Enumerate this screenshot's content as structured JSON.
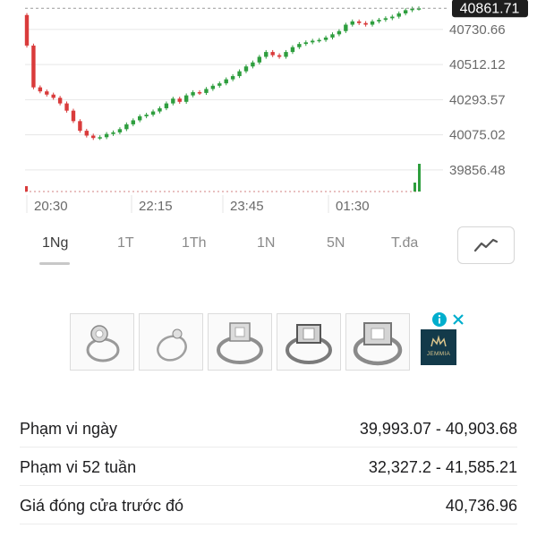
{
  "chart": {
    "current_price_label": "40861.71",
    "y_ticks": [
      "40730.66",
      "40512.12",
      "40293.57",
      "40075.02",
      "39856.48"
    ],
    "x_ticks": [
      "20:30",
      "22:15",
      "23:45",
      "01:30"
    ],
    "colors": {
      "up": "#2e9e3e",
      "down": "#d93b3b",
      "grid": "#e6e6e6",
      "label_bg": "#1e1e1e"
    }
  },
  "tabs": [
    "1Ng",
    "1T",
    "1Th",
    "1N",
    "5N",
    "T.đa"
  ],
  "active_tab": "1Ng",
  "chart_toggle_icon": "line-chart-icon",
  "ad": {
    "thumbnails": [
      "ring-1",
      "ring-2",
      "ring-3",
      "ring-4",
      "ring-5"
    ],
    "brand": "JEMMIA",
    "info_icon": "info-icon",
    "close_icon": "close-icon"
  },
  "stats": [
    {
      "label": "Phạm vi ngày",
      "value": "39,993.07 - 40,903.68"
    },
    {
      "label": "Phạm vi 52 tuần",
      "value": "32,327.2 - 41,585.21"
    },
    {
      "label": "Giá đóng cửa trước đó",
      "value": "40,736.96"
    }
  ],
  "chart_data": {
    "type": "line",
    "title": "",
    "xlabel": "",
    "ylabel": "",
    "x_ticks": [
      "20:30",
      "22:15",
      "23:45",
      "01:30"
    ],
    "ylim": [
      39800,
      40880
    ],
    "y_ticks": [
      40730.66,
      40512.12,
      40293.57,
      40075.02,
      39856.48
    ],
    "last_price": 40861.71,
    "series": [
      {
        "name": "",
        "values": [
          40630,
          40370,
          40345,
          40325,
          40305,
          40270,
          40225,
          40160,
          40100,
          40070,
          40055,
          40060,
          40080,
          40090,
          40110,
          40140,
          40165,
          40190,
          40200,
          40220,
          40240,
          40270,
          40300,
          40280,
          40320,
          40340,
          40335,
          40360,
          40380,
          40395,
          40420,
          40440,
          40470,
          40500,
          40525,
          40560,
          40590,
          40570,
          40560,
          40590,
          40620,
          40640,
          40650,
          40660,
          40665,
          40680,
          40700,
          40720,
          40760,
          40780,
          40770,
          40760,
          40780,
          40790,
          40800,
          40810,
          40830,
          40850,
          40860,
          40861.71
        ]
      }
    ]
  }
}
